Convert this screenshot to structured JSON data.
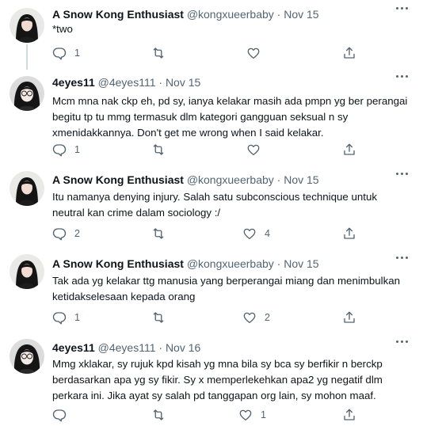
{
  "tweets": [
    {
      "name": "A Snow Kong Enthusiast",
      "handle": "@kongxueerbaby",
      "separator": "·",
      "date": "Nov 15",
      "text": "*two",
      "reply_count": "1",
      "retweet_count": "",
      "like_count": "",
      "avatar": "long-haired-woman-avatar"
    },
    {
      "name": "4eyes11",
      "handle": "@4eyes111",
      "separator": "·",
      "date": "Nov 15",
      "text": "Mcm mna nak ckp eh, pd sy, ianya kelakar masih ada pmpn yg ber perangai begitu tp tu mmg termasuk dlm kategori gangguan seksual n sy xmenidakkannya. Don't get me wrong when I said kelakar.",
      "reply_count": "1",
      "retweet_count": "",
      "like_count": "",
      "avatar": "glasses-woman-avatar"
    },
    {
      "name": "A Snow Kong Enthusiast",
      "handle": "@kongxueerbaby",
      "separator": "·",
      "date": "Nov 15",
      "text": "Itu namanya denying injury. Salah satu subconscious technique untuk neutral kan crime dalam sociology :/",
      "reply_count": "2",
      "retweet_count": "",
      "like_count": "4",
      "avatar": "long-haired-woman-avatar"
    },
    {
      "name": "A Snow Kong Enthusiast",
      "handle": "@kongxueerbaby",
      "separator": "·",
      "date": "Nov 15",
      "text": "Tak ada yg kelakar ttg manusia yang berperangai miang dan menimbulkan ketidakselesaan kepada orang",
      "reply_count": "1",
      "retweet_count": "",
      "like_count": "2",
      "avatar": "long-haired-woman-avatar"
    },
    {
      "name": "4eyes11",
      "handle": "@4eyes111",
      "separator": "·",
      "date": "Nov 16",
      "text": "Mmg xklakar, sy rujuk kpd kisah yg mna bila sy bca sy berfikir n berckp berdasarkan apa yg sy fikir. Sy x memperlekehkan apa2 yg negatif dlm perkara ini. Jika ayat sy salah pd tanggapan org lain, sy mohon maaf.",
      "reply_count": "",
      "retweet_count": "",
      "like_count": "1",
      "avatar": "glasses-woman-avatar"
    }
  ]
}
